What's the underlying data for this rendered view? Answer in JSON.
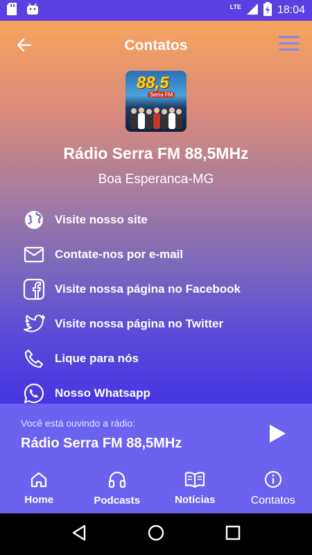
{
  "status_bar": {
    "time": "18:04",
    "network": "LTE",
    "icons": [
      "sd-card-icon",
      "android-icon",
      "signal-icon",
      "battery-icon"
    ]
  },
  "header": {
    "title": "Contatos",
    "back_icon": "arrow-left-icon",
    "menu_icon": "hamburger-menu-icon"
  },
  "logo": {
    "frequency": "88,5",
    "sub": "Serra FM"
  },
  "station": {
    "name": "Rádio Serra FM 88,5MHz",
    "city": "Boa Esperanca-MG"
  },
  "contacts": [
    {
      "icon": "globe-icon",
      "label": "Visite nosso site"
    },
    {
      "icon": "email-icon",
      "label": "Contate-nos por e-mail"
    },
    {
      "icon": "facebook-icon",
      "label": "Visite nossa página no Facebook"
    },
    {
      "icon": "twitter-icon",
      "label": "Visite nossa página no Twitter"
    },
    {
      "icon": "phone-icon",
      "label": "Lique para nós"
    },
    {
      "icon": "whatsapp-icon",
      "label": "Nosso Whatsapp"
    }
  ],
  "player": {
    "prefix": "Você está ouvindo a rádio:",
    "station": "Rádio Serra FM 88,5MHz",
    "play_icon": "play-icon"
  },
  "bottom_nav": {
    "items": [
      {
        "icon": "home-icon",
        "label": "Home"
      },
      {
        "icon": "headphones-icon",
        "label": "Podcasts"
      },
      {
        "icon": "book-icon",
        "label": "Notícias"
      },
      {
        "icon": "info-icon",
        "label": "Contatos"
      }
    ],
    "active": "Contatos"
  },
  "colors": {
    "gradient_top": "#f7a35c",
    "gradient_bottom": "#4636e3",
    "accent": "#6b63f0",
    "status_bar": "#5b3fe0"
  }
}
